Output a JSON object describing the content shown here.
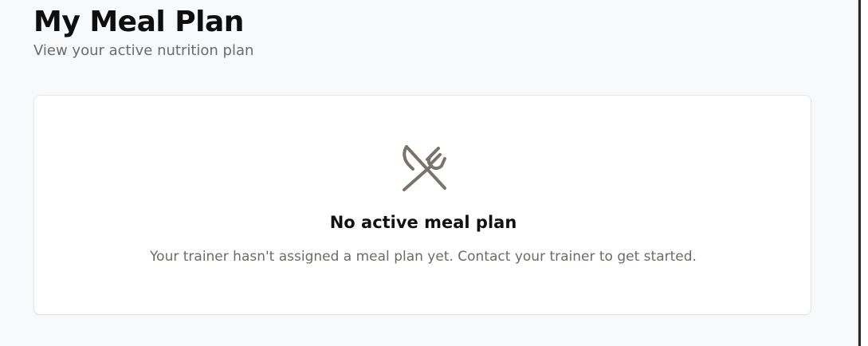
{
  "header": {
    "title": "My Meal Plan",
    "subtitle": "View your active nutrition plan"
  },
  "empty_state": {
    "icon": "utensils-crossed-icon",
    "title": "No active meal plan",
    "message": "Your trainer hasn't assigned a meal plan yet. Contact your trainer to get started."
  },
  "colors": {
    "background": "#f8f9fa",
    "card": "#ffffff",
    "muted_text": "#6f6a66",
    "icon": "#7a726d"
  }
}
